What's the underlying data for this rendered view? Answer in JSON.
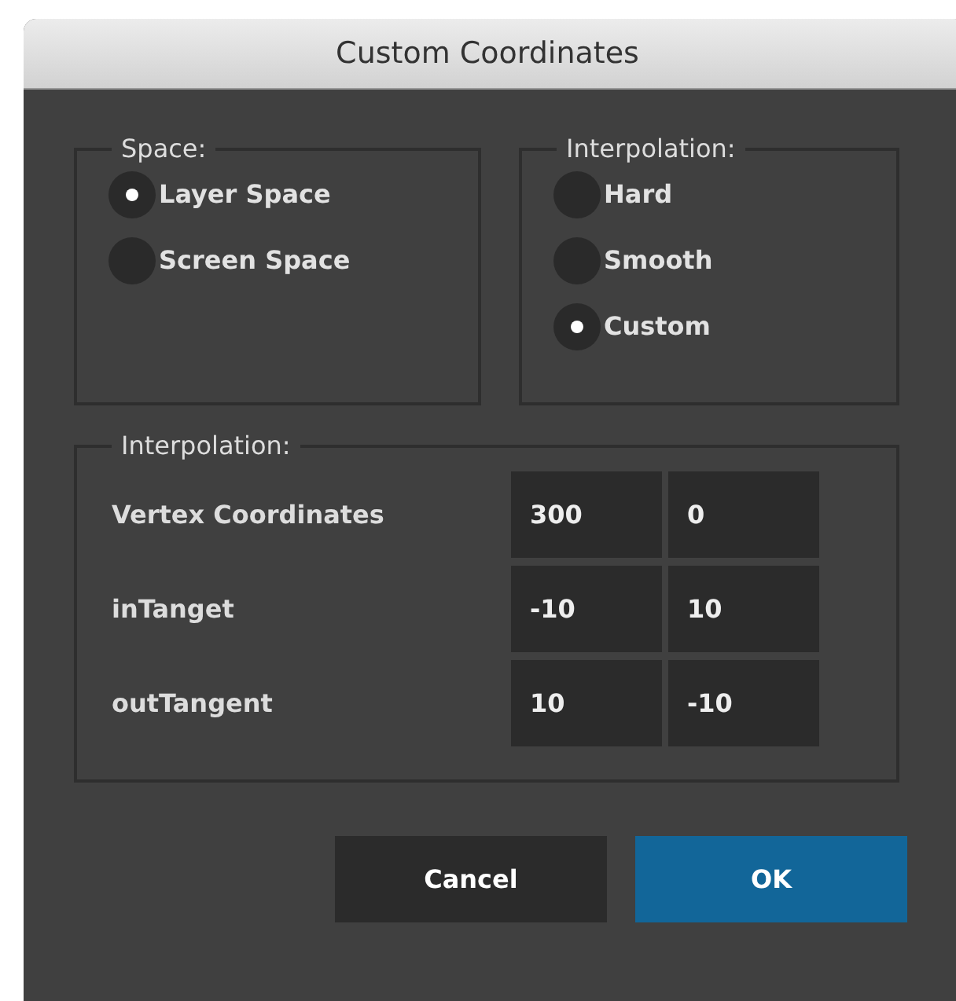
{
  "window": {
    "title": "Custom Coordinates"
  },
  "space": {
    "legend": "Space:",
    "options": [
      {
        "label": "Layer Space",
        "selected": true
      },
      {
        "label": "Screen Space",
        "selected": false
      }
    ]
  },
  "interpolation": {
    "legend": "Interpolation:",
    "options": [
      {
        "label": "Hard",
        "selected": false
      },
      {
        "label": "Smooth",
        "selected": false
      },
      {
        "label": "Custom",
        "selected": true
      }
    ]
  },
  "coordinates": {
    "legend": "Interpolation:",
    "rows": [
      {
        "label": "Vertex Coordinates",
        "values": [
          "300",
          "0"
        ]
      },
      {
        "label": "inTanget",
        "values": [
          "-10",
          "10"
        ]
      },
      {
        "label": "outTangent",
        "values": [
          "10",
          "-10"
        ]
      }
    ]
  },
  "buttons": [
    {
      "label": "Cancel",
      "kind": "cancel"
    },
    {
      "label": "OK",
      "kind": "confirm"
    }
  ]
}
